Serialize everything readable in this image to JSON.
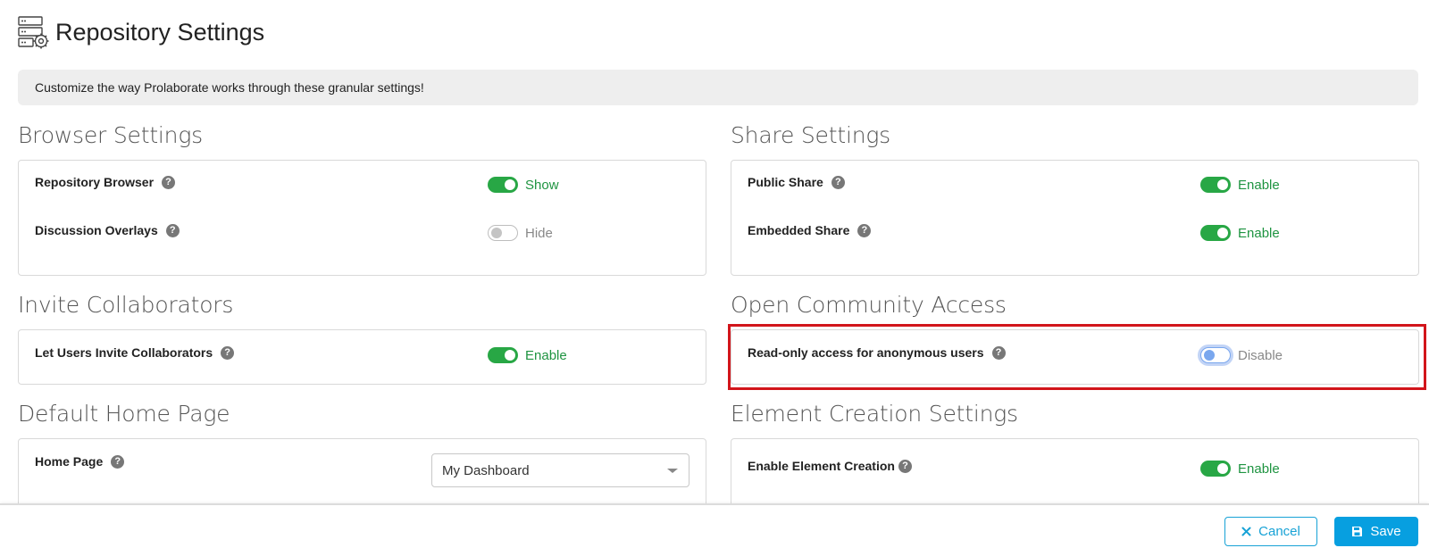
{
  "page": {
    "title": "Repository Settings",
    "banner": "Customize the way Prolaborate works through these granular settings!"
  },
  "sections": {
    "browser": {
      "title": "Browser Settings",
      "repository_browser": {
        "label": "Repository Browser",
        "state": "Show",
        "on": true
      },
      "discussion_overlays": {
        "label": "Discussion Overlays",
        "state": "Hide",
        "on": false
      }
    },
    "share": {
      "title": "Share Settings",
      "public_share": {
        "label": "Public Share",
        "state": "Enable",
        "on": true
      },
      "embedded_share": {
        "label": "Embedded Share",
        "state": "Enable",
        "on": true
      }
    },
    "invite": {
      "title": "Invite Collaborators",
      "let_users_invite": {
        "label": "Let Users Invite Collaborators",
        "state": "Enable",
        "on": true
      }
    },
    "community": {
      "title": "Open Community Access",
      "readonly_anonymous": {
        "label": "Read-only access for anonymous users",
        "state": "Disable",
        "on": false
      }
    },
    "home": {
      "title": "Default Home Page",
      "home_page": {
        "label": "Home Page",
        "selected": "My Dashboard"
      }
    },
    "element": {
      "title": "Element Creation Settings",
      "enable_element_creation": {
        "label": "Enable Element Creation",
        "state": "Enable",
        "on": true
      }
    }
  },
  "footer": {
    "cancel_label": "Cancel",
    "save_label": "Save"
  },
  "icons": {
    "header": "server-settings-icon",
    "help": "help-icon",
    "cancel": "close-icon",
    "save": "floppy-disk-icon"
  },
  "colors": {
    "toggle_on": "#28a745",
    "toggle_on_text": "#1f9441",
    "highlight": "#d2151b",
    "primary": "#079fe0"
  },
  "help_glyph": "?"
}
